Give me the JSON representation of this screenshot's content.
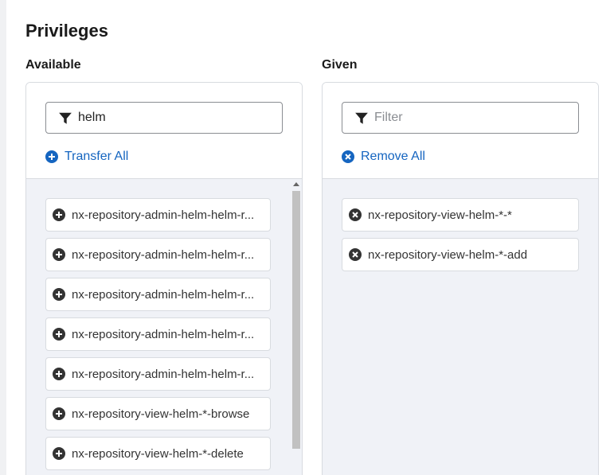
{
  "section": {
    "title": "Privileges"
  },
  "available": {
    "label": "Available",
    "filter": {
      "value": "helm",
      "placeholder": "Filter"
    },
    "action_label": "Transfer All",
    "items": [
      {
        "label": "nx-repository-admin-helm-helm-r..."
      },
      {
        "label": "nx-repository-admin-helm-helm-r..."
      },
      {
        "label": "nx-repository-admin-helm-helm-r..."
      },
      {
        "label": "nx-repository-admin-helm-helm-r..."
      },
      {
        "label": "nx-repository-admin-helm-helm-r..."
      },
      {
        "label": "nx-repository-view-helm-*-browse"
      },
      {
        "label": "nx-repository-view-helm-*-delete"
      }
    ]
  },
  "given": {
    "label": "Given",
    "filter": {
      "value": "",
      "placeholder": "Filter"
    },
    "action_label": "Remove All",
    "items": [
      {
        "label": "nx-repository-view-helm-*-*"
      },
      {
        "label": "nx-repository-view-helm-*-add"
      }
    ]
  },
  "colors": {
    "link": "#1565c0",
    "icon_dark": "#333333",
    "list_bg": "#f0f2f7"
  }
}
